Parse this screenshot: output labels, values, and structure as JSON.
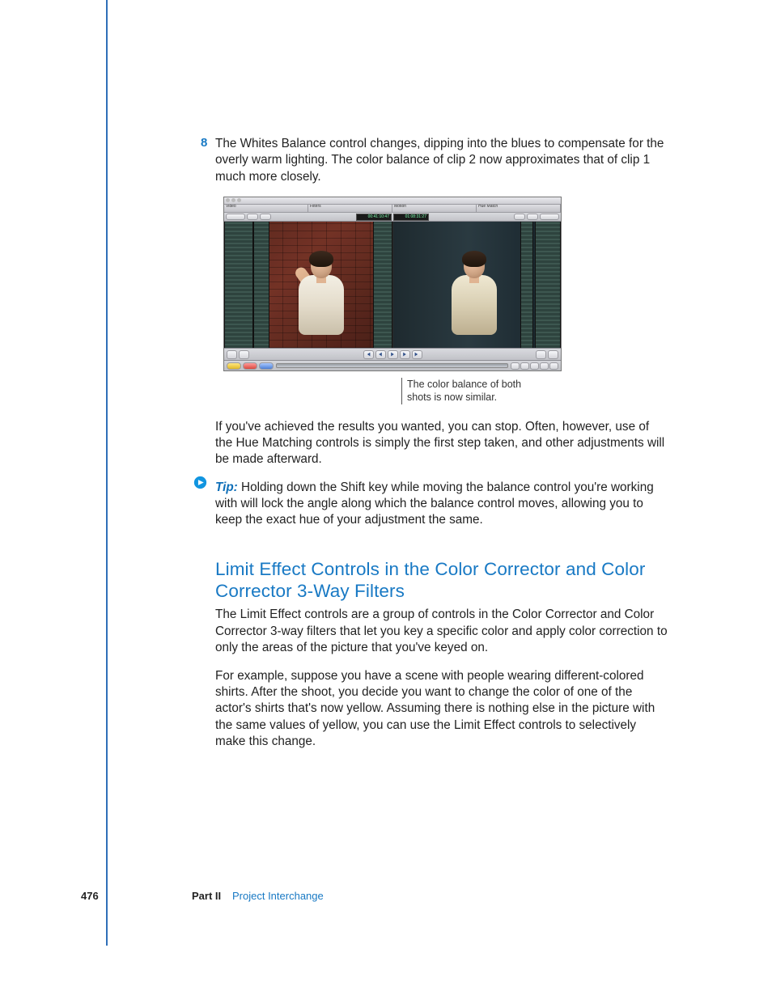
{
  "step": {
    "number": "8",
    "text": "The Whites Balance control changes, dipping into the blues to compensate for the overly warm lighting. The color balance of clip 2 now approximates that of clip 1 much more closely."
  },
  "figure": {
    "tabs": [
      "Video",
      "Filters",
      "Motion",
      "Hue Match"
    ],
    "timecode_left": "00:41:10:47",
    "timecode_right": "01:08:31:27",
    "callout": "The color balance of both shots is now similar."
  },
  "para_after_figure": "If you've achieved the results you wanted, you can stop. Often, however, use of the Hue Matching controls is simply the first step taken, and other adjustments will be made afterward.",
  "tip": {
    "label": "Tip:",
    "text": "Holding down the Shift key while moving the balance control you're working with will lock the angle along which the balance control moves, allowing you to keep the exact hue of your adjustment the same."
  },
  "section_heading": "Limit Effect Controls in the Color Corrector and Color Corrector 3-Way Filters",
  "section_p1": "The Limit Effect controls are a group of controls in the Color Corrector and Color Corrector 3-way filters that let you key a specific color and apply color correction to only the areas of the picture that you've keyed on.",
  "section_p2": "For example, suppose you have a scene with people wearing different-colored shirts. After the shoot, you decide you want to change the color of one of the actor's shirts that's now yellow. Assuming there is nothing else in the picture with the same values of yellow, you can use the Limit Effect controls to selectively make this change.",
  "footer": {
    "page_number": "476",
    "part_label": "Part II",
    "part_name": "Project Interchange"
  }
}
